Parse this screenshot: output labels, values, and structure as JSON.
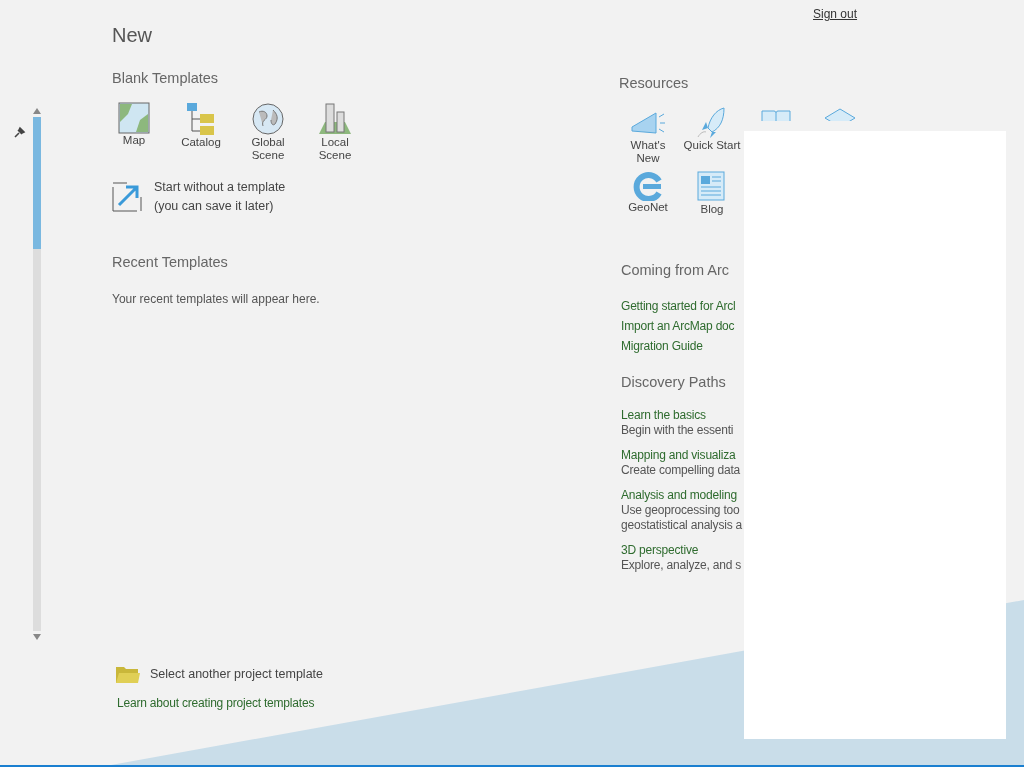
{
  "title": "New",
  "account": {
    "sign_out": "Sign out"
  },
  "blank_templates": {
    "heading": "Blank Templates",
    "items": [
      {
        "label": "Map",
        "kind": "map"
      },
      {
        "label": "Catalog",
        "kind": "catalog"
      },
      {
        "label": "Global Scene",
        "kind": "globe"
      },
      {
        "label": "Local Scene",
        "kind": "local"
      }
    ],
    "start_without": {
      "line1": "Start without a template",
      "line2": "(you can save it later)"
    }
  },
  "recent_templates": {
    "heading": "Recent Templates",
    "empty_message": "Your recent templates will appear here."
  },
  "project_template": {
    "select": "Select another project template",
    "learn_link": "Learn about creating project templates"
  },
  "resources": {
    "heading": "Resources",
    "items": [
      {
        "label": "What's New",
        "kind": "megaphone"
      },
      {
        "label": "Quick Start",
        "kind": "rocket"
      },
      {
        "kind": "book"
      },
      {
        "kind": "cap"
      },
      {
        "label": "GeoNet",
        "kind": "geonet"
      },
      {
        "label": "Blog",
        "kind": "blog"
      }
    ]
  },
  "coming_from": {
    "heading": "Coming from Arc",
    "links": [
      "Getting started for Arcl",
      "Import an ArcMap doc",
      "Migration Guide"
    ]
  },
  "discovery_paths": {
    "heading": "Discovery Paths",
    "items": [
      {
        "title": "Learn the basics",
        "description_lines": [
          "Begin with the essenti"
        ]
      },
      {
        "title": "Mapping and visualiza",
        "description_lines": [
          "Create compelling data"
        ]
      },
      {
        "title": "Analysis and modeling",
        "description_lines": [
          "Use geoprocessing too",
          "geostatistical analysis a"
        ]
      },
      {
        "title": "3D perspective",
        "description_lines": [
          "Explore, analyze, and s"
        ]
      }
    ]
  }
}
